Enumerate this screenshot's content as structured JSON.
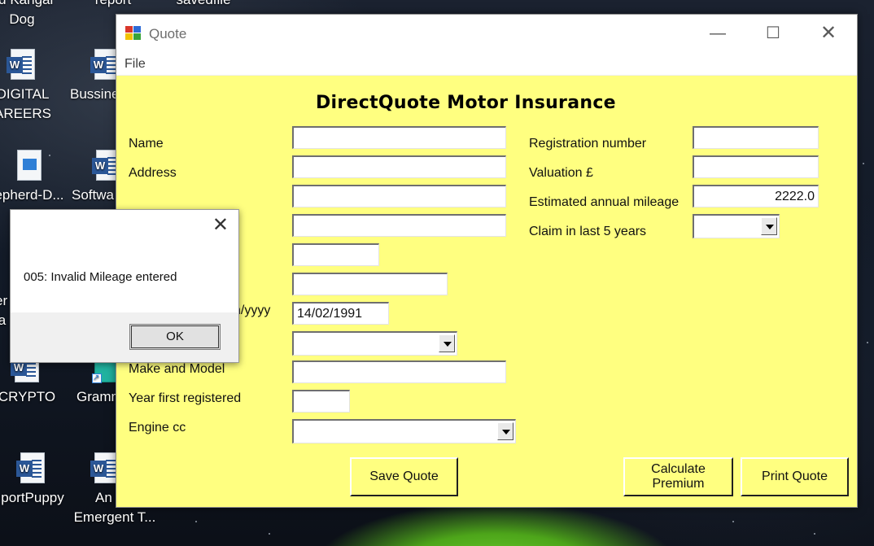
{
  "desktop": {
    "icons": [
      {
        "label": "ed Kangal",
        "label2": "Dog",
        "type": "text"
      },
      {
        "label": "report",
        "label2": "",
        "type": "text"
      },
      {
        "label": "savedfile",
        "label2": "",
        "type": "text"
      },
      {
        "label": "DIGITAL",
        "label2": "AREERS",
        "type": "word"
      },
      {
        "label": "Bussine",
        "label2": "",
        "type": "word"
      },
      {
        "label": "epherd-D...",
        "label2": "",
        "type": "image"
      },
      {
        "label": "Softwa",
        "label2": "",
        "type": "word"
      },
      {
        "label": "er",
        "label2": "la",
        "type": "word"
      },
      {
        "label": "CRYPTO",
        "label2": "",
        "type": "word"
      },
      {
        "label": "Gramm",
        "label2": "",
        "type": "shortcut"
      },
      {
        "label": "portPuppy",
        "label2": "",
        "type": "word"
      },
      {
        "label": "An",
        "label2": "Emergent T...",
        "type": "word"
      }
    ]
  },
  "window": {
    "title": "Quote",
    "min_glyph": "—",
    "max_glyph": "☐",
    "close_glyph": "✕",
    "menu_file": "File",
    "app_icon": "winforms-app-icon"
  },
  "form": {
    "heading": "DirectQuote Motor Insurance",
    "labels": {
      "name": "Name",
      "address": "Address",
      "dob_partial": "n/yyyy",
      "make_model": "Make and Model",
      "year_registered": "Year first registered",
      "engine_cc": "Engine cc",
      "registration": "Registration number",
      "valuation": "Valuation £",
      "mileage": "Estimated annual mileage",
      "claim": "Claim in last 5 years"
    },
    "values": {
      "name": "",
      "address1": "",
      "address2": "",
      "address3": "",
      "postcode": "",
      "phone": "",
      "dob": "14/02/1991",
      "make_model": "",
      "year_registered": "",
      "registration": "",
      "valuation": "",
      "mileage": "2222.0"
    },
    "buttons": {
      "save": "Save Quote",
      "calculate_line1": "Calculate",
      "calculate_line2": "Premium",
      "print": "Print Quote"
    }
  },
  "dialog": {
    "close_glyph": "✕",
    "message": "005: Invalid Mileage entered",
    "ok_label": "OK"
  },
  "colors": {
    "form_background": "#ffff80",
    "window_background": "#ffffff"
  }
}
